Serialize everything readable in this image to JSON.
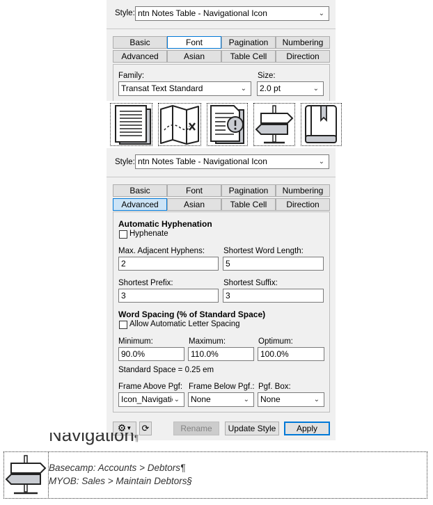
{
  "top": {
    "style_label": "Style:",
    "style_value": "ntn Notes Table - Navigational Icon",
    "tabs_row1": [
      "Basic",
      "Font",
      "Pagination",
      "Numbering"
    ],
    "tabs_row2": [
      "Advanced",
      "Asian",
      "Table Cell",
      "Direction"
    ],
    "active_tab": "Font",
    "family_label": "Family:",
    "family_value": "Transat Text Standard",
    "size_label": "Size:",
    "size_value": "2.0 pt"
  },
  "icons": [
    "document-stack-icon",
    "map-icon",
    "document-alert-icon",
    "signpost-icon",
    "bookmark-book-icon"
  ],
  "bottom": {
    "style_label": "Style:",
    "style_value": "ntn Notes Table - Navigational Icon",
    "tabs_row1": [
      "Basic",
      "Font",
      "Pagination",
      "Numbering"
    ],
    "tabs_row2": [
      "Advanced",
      "Asian",
      "Table Cell",
      "Direction"
    ],
    "active_tab": "Advanced",
    "hyph_title": "Automatic Hyphenation",
    "hyphenate_label": "Hyphenate",
    "hyphenate_checked": false,
    "max_adj_label": "Max. Adjacent Hyphens:",
    "max_adj_value": "2",
    "shortest_word_label": "Shortest Word Length:",
    "shortest_word_value": "5",
    "shortest_prefix_label": "Shortest Prefix:",
    "shortest_prefix_value": "3",
    "shortest_suffix_label": "Shortest Suffix:",
    "shortest_suffix_value": "3",
    "spacing_title": "Word Spacing (% of Standard Space)",
    "allow_letter_label": "Allow Automatic Letter Spacing",
    "allow_letter_checked": false,
    "min_label": "Minimum:",
    "min_value": "90.0%",
    "max_label": "Maximum:",
    "max_value": "110.0%",
    "opt_label": "Optimum:",
    "opt_value": "100.0%",
    "std_space": "Standard Space = 0.25 em",
    "frame_above_label": "Frame Above Pgf:",
    "frame_above_value": "Icon_Navigatio",
    "frame_below_label": "Frame Below Pgf.:",
    "frame_below_value": "None",
    "pgf_box_label": "Pgf. Box:",
    "pgf_box_value": "None",
    "rename_label": "Rename",
    "update_label": "Update Style",
    "apply_label": "Apply"
  },
  "document": {
    "heading": "Navigation",
    "heading_mark": "¶",
    "line1": "Basecamp: Accounts > Debtors¶",
    "line2": "MYOB: Sales > Maintain Debtors§"
  },
  "colors": {
    "panel": "#f0f0f0",
    "accent": "#0078d7",
    "active_tab": "#cce4f7"
  }
}
